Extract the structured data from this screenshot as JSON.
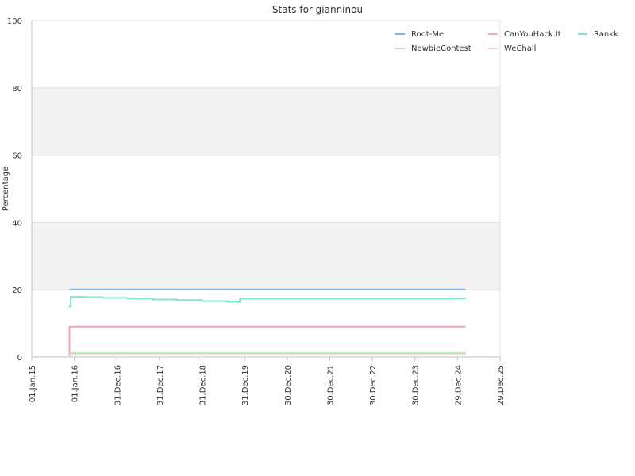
{
  "chart_data": {
    "type": "line",
    "title": "Stats for gianninou",
    "xlabel": "",
    "ylabel": "Percentage",
    "ylim": [
      0,
      100
    ],
    "xlim": [
      "2015-01-01",
      "2025-12-29"
    ],
    "x_ticks": [
      "01.Jan.15",
      "01.Jan.16",
      "31.Dec.16",
      "31.Dec.17",
      "31.Dec.18",
      "31.Dec.19",
      "30.Dec.20",
      "30.Dec.21",
      "30.Dec.22",
      "30.Dec.23",
      "29.Dec.24",
      "29.Dec.25"
    ],
    "y_ticks": [
      0,
      20,
      40,
      60,
      80,
      100
    ],
    "grid": true,
    "alternating_bands": true,
    "legend_position": "top-right",
    "series": [
      {
        "name": "Root-Me",
        "color": "#7cb5ec",
        "points": [
          [
            "2015-11-20",
            20.1
          ],
          [
            "2025-03-10",
            20.1
          ]
        ]
      },
      {
        "name": "CanYouHack.It",
        "color": "#f7a1c4",
        "points": [
          [
            "2015-11-15",
            0.5
          ],
          [
            "2015-11-20",
            9.0
          ],
          [
            "2025-03-10",
            9.0
          ]
        ]
      },
      {
        "name": "Rankk",
        "color": "#7ee6d1",
        "points": [
          [
            "2015-11-15",
            15.0
          ],
          [
            "2015-12-01",
            17.9
          ],
          [
            "2016-04-01",
            17.8
          ],
          [
            "2016-09-01",
            17.6
          ],
          [
            "2017-04-01",
            17.4
          ],
          [
            "2017-11-01",
            17.1
          ],
          [
            "2018-06-01",
            16.9
          ],
          [
            "2019-01-01",
            16.6
          ],
          [
            "2019-08-01",
            16.4
          ],
          [
            "2019-11-01",
            16.3
          ],
          [
            "2019-11-20",
            17.4
          ],
          [
            "2025-03-10",
            17.4
          ]
        ]
      },
      {
        "name": "NewbieContest",
        "color": "#b3ecb3",
        "points": [
          [
            "2015-11-20",
            1.2
          ],
          [
            "2025-03-10",
            1.2
          ]
        ]
      },
      {
        "name": "WeChall",
        "color": "#f7d3d3",
        "points": [
          [
            "2015-11-20",
            0.8
          ],
          [
            "2025-03-10",
            0.8
          ]
        ]
      }
    ]
  }
}
